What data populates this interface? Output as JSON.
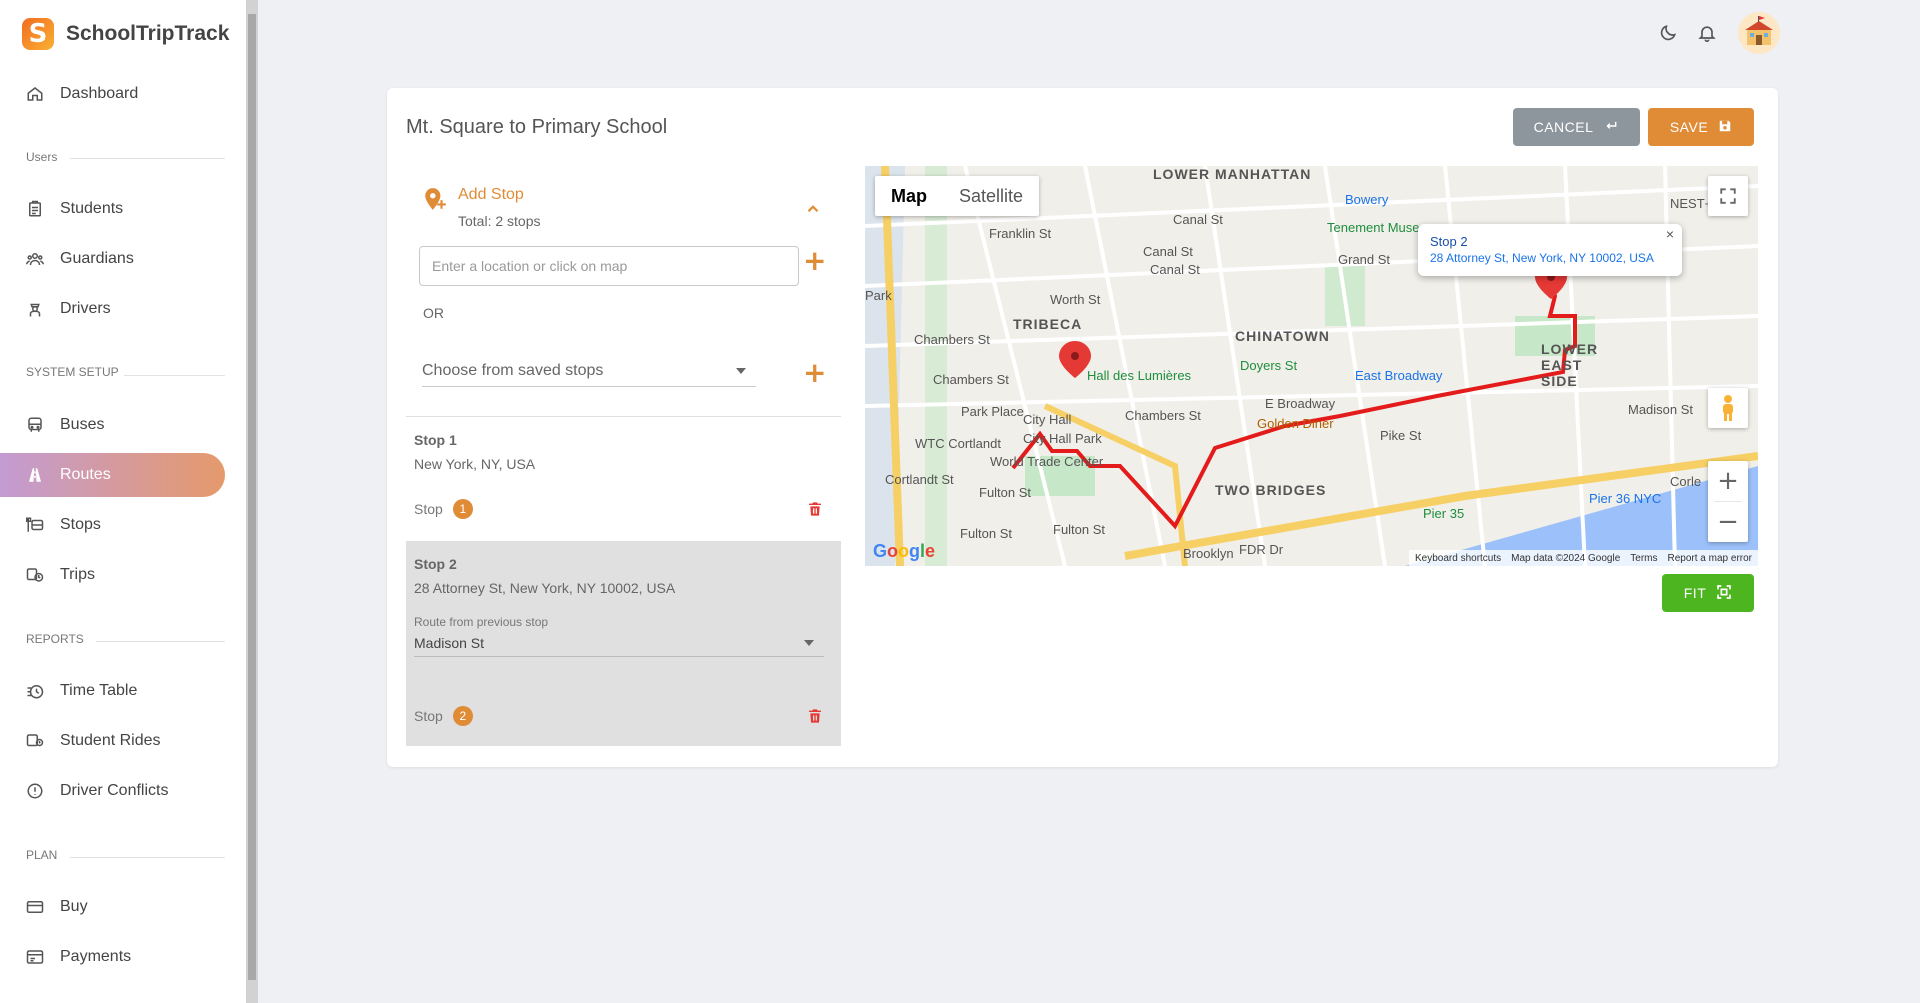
{
  "brand": {
    "name": "SchoolTripTrack",
    "logo_letter": "S"
  },
  "sidebar": {
    "items": [
      {
        "label": "Dashboard",
        "icon": "home-icon"
      },
      {
        "label": "Students",
        "icon": "clipboard-icon"
      },
      {
        "label": "Guardians",
        "icon": "people-icon"
      },
      {
        "label": "Drivers",
        "icon": "driver-icon"
      },
      {
        "label": "Buses",
        "icon": "bus-icon"
      },
      {
        "label": "Routes",
        "icon": "road-icon",
        "active": true
      },
      {
        "label": "Stops",
        "icon": "bus-stop-icon"
      },
      {
        "label": "Trips",
        "icon": "bus-clock-icon"
      },
      {
        "label": "Time Table",
        "icon": "timetable-icon"
      },
      {
        "label": "Student Rides",
        "icon": "student-rides-icon"
      },
      {
        "label": "Driver Conflicts",
        "icon": "alert-icon"
      },
      {
        "label": "Buy",
        "icon": "card-icon"
      },
      {
        "label": "Payments",
        "icon": "payments-icon"
      }
    ],
    "sections": [
      "Users",
      "SYSTEM SETUP",
      "REPORTS",
      "PLAN"
    ]
  },
  "page": {
    "title": "Mt. Square to Primary School",
    "cancel_label": "CANCEL",
    "save_label": "SAVE",
    "fit_label": "FIT"
  },
  "add_stop": {
    "title": "Add Stop",
    "subtitle": "Total: 2 stops",
    "location_placeholder": "Enter a location or click on map",
    "or_label": "OR",
    "saved_stops_placeholder": "Choose from saved stops"
  },
  "stops": [
    {
      "name": "Stop 1",
      "address": "New York, NY, USA",
      "label": "Stop",
      "number": "1"
    },
    {
      "name": "Stop 2",
      "address": "28 Attorney St, New York, NY 10002, USA",
      "label": "Stop",
      "number": "2",
      "route_from_label": "Route from previous stop",
      "route_from_value": "Madison St"
    }
  ],
  "map": {
    "type_map": "Map",
    "type_satellite": "Satellite",
    "infowindow": {
      "title": "Stop 2",
      "address": "28 Attorney St, New York, NY 10002, USA",
      "close": "×"
    },
    "footer": [
      "Keyboard shortcuts",
      "Map data ©2024 Google",
      "Terms",
      "Report a map error"
    ],
    "logo": "Google",
    "labels": {
      "lower_manhattan": "LOWER MANHATTAN",
      "tribeca": "TRIBECA",
      "chinatown": "CHINATOWN",
      "lower_east_side": "LOWER EAST SIDE",
      "two_bridges": "TWO BRIDGES",
      "canal_st": "Canal St",
      "canal_st_2": "Canal St",
      "canal_st_3": "Canal St",
      "chambers_st": "Chambers St",
      "chambers_st_2": "Chambers St",
      "chambers_st_3": "Chambers St",
      "franklin_st": "Franklin St",
      "grand_st": "Grand St",
      "east_broadway": "East Broadway",
      "e_broadway": "E Broadway",
      "doyers_st": "Doyers St",
      "hall_lumieres": "Hall des Lumières",
      "golden_diner": "Golden Diner",
      "park_place": "Park Place",
      "wtc_cortlandt": "WTC Cortlandt",
      "world_trade_center": "World Trade Center",
      "cortlandt_st": "Cortlandt St",
      "fulton_st": "Fulton St",
      "fulton_st_2": "Fulton St",
      "fulton_st_3": "Fulton St",
      "city_hall_park": "City Hall Park",
      "city_hall": "City Hall",
      "pier_35": "Pier 35",
      "pier_36": "Pier 36 NYC",
      "tenement_museum": "Tenement Museum",
      "bowery": "Bowery",
      "madison_st": "Madison St",
      "fdr_dr": "FDR Dr",
      "pike_st": "Pike St",
      "worth_st": "Worth St",
      "nest": "NEST+m",
      "corlears": "Corle",
      "park": "Park",
      "brooklyn": "Brooklyn"
    }
  },
  "colors": {
    "accent": "#e08c36",
    "cancel": "#8e969d",
    "fit": "#4cb51f",
    "route": "#e31b1b"
  }
}
